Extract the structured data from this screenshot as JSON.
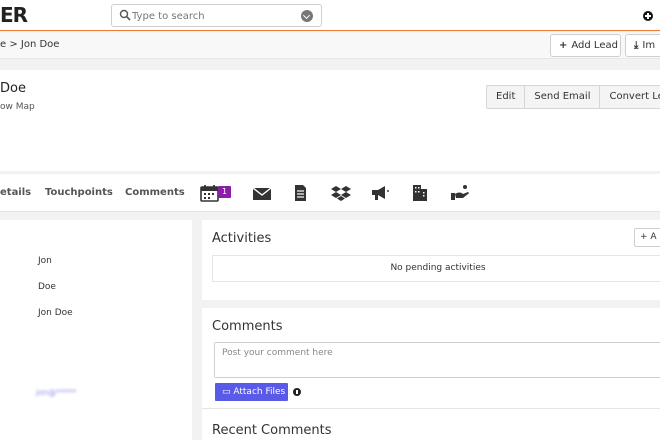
{
  "topbar": {
    "logo_text": "ER",
    "search_placeholder": "Type to search"
  },
  "breadcrumb": {
    "text": "e > Jon Doe"
  },
  "toolbar": {
    "add_lead_label": "Add Lead",
    "import_label": "Im"
  },
  "lead": {
    "name": "Doe",
    "show_map_label": "ow Map"
  },
  "actions": {
    "edit_label": "Edit",
    "send_email_label": "Send Email",
    "convert_lead_label": "Convert Lead"
  },
  "tabs": {
    "details_label": "etails",
    "touchpoints_label": "Touchpoints",
    "comments_label": "Comments",
    "calendar_badge": "1",
    "icons": [
      "calendar-icon",
      "envelope-icon",
      "document-icon",
      "dropbox-icon",
      "megaphone-icon",
      "building-icon",
      "hand-icon"
    ]
  },
  "details": {
    "first_name": "Jon",
    "last_name": "Doe",
    "full_name": "Jon Doe",
    "email_blurred": "jon@*****"
  },
  "activities": {
    "title": "Activities",
    "add_label": "A",
    "empty_text": "No pending activities"
  },
  "comments": {
    "title": "Comments",
    "placeholder": "Post your comment here",
    "attach_label": "Attach Files",
    "recent_title": "Recent Comments"
  },
  "colors": {
    "accent_orange": "#f07a3a",
    "attach_button": "#5a5ae8",
    "badge_purple": "#8a1ea8"
  }
}
